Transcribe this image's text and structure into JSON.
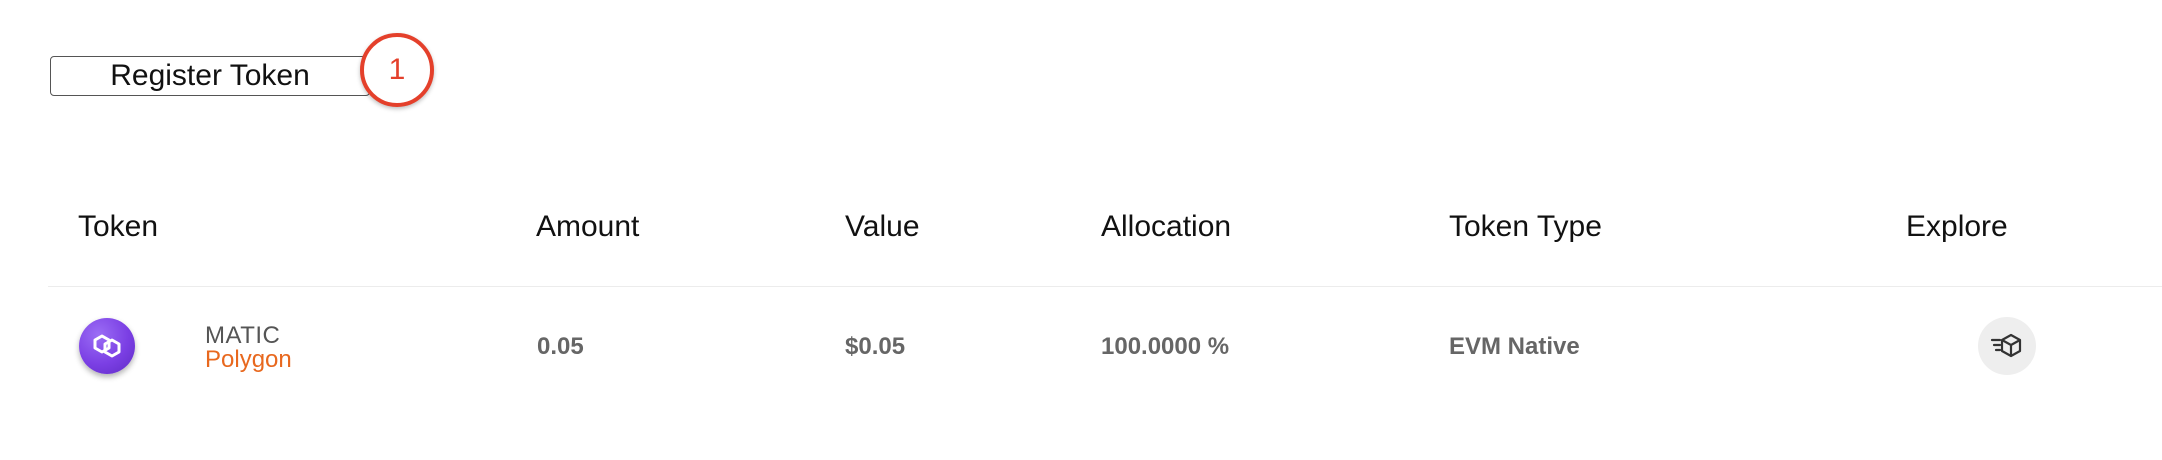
{
  "toolbar": {
    "register_label": "Register Token",
    "callout_number": "1"
  },
  "table": {
    "columns": [
      "Token",
      "Amount",
      "Value",
      "Allocation",
      "Token Type",
      "Explore"
    ],
    "rows": [
      {
        "symbol": "MATIC",
        "network": "Polygon",
        "amount": "0.05",
        "value": "$0.05",
        "allocation": "100.0000 %",
        "token_type": "EVM Native",
        "logo_icon": "polygon-logo-icon",
        "explore_icon": "block-explorer-icon"
      }
    ]
  },
  "colors": {
    "callout": "#e4402b",
    "network_text": "#e8681e",
    "polygon_purple": "#7b3fe4",
    "cell_text": "#666666"
  }
}
